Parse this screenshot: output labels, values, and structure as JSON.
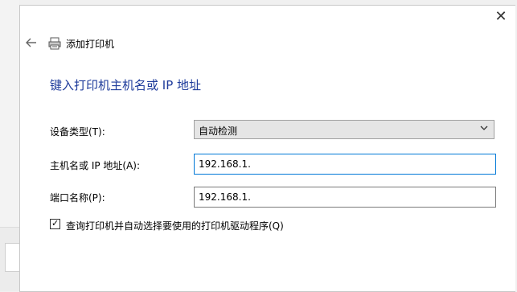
{
  "window": {
    "title": "添加打印机",
    "close_label": "✕"
  },
  "page": {
    "heading": "键入打印机主机名或 IP 地址"
  },
  "form": {
    "device_type": {
      "label": "设备类型(T):",
      "value": "自动检测"
    },
    "hostname": {
      "label": "主机名或 IP 地址(A):",
      "value": "192.168.1."
    },
    "port_name": {
      "label": "端口名称(P):",
      "value": "192.168.1."
    },
    "auto_select": {
      "label": "查询打印机并自动选择要使用的打印机驱动程序(Q)",
      "checked": true
    }
  },
  "icons": [
    "back-arrow-icon",
    "printer-icon",
    "close-icon",
    "chevron-down-icon",
    "checkmark-icon"
  ]
}
